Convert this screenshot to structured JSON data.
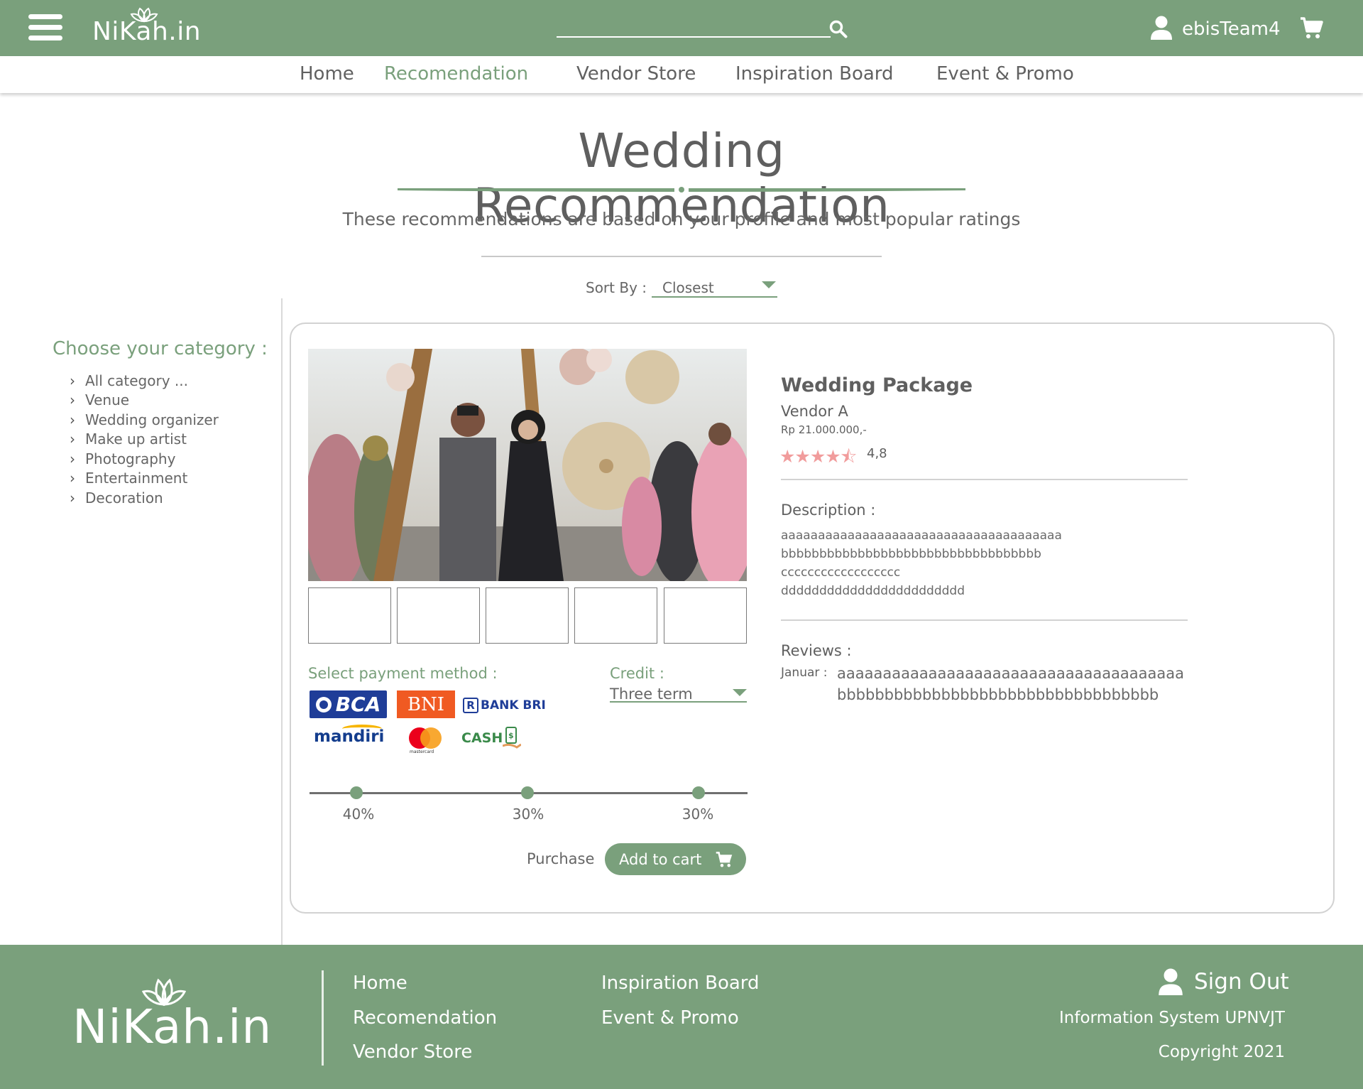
{
  "header": {
    "logo": "NiKah.in",
    "username": "ebisTeam4",
    "icons": [
      "hamburger-icon",
      "search-icon",
      "user-icon",
      "cart-icon"
    ]
  },
  "nav": {
    "items": [
      "Home",
      "Recomendation",
      "Vendor Store",
      "Inspiration Board",
      "Event & Promo"
    ],
    "active": "Recomendation"
  },
  "page": {
    "title": "Wedding Recommendation",
    "subtitle": "These recommendations are based on your profile and most popular ratings",
    "sort_label": "Sort By :",
    "sort_value": "Closest"
  },
  "sidebar": {
    "title": "Choose your category :",
    "items": [
      "All category ...",
      "Venue",
      "Wedding organizer",
      "Make up artist",
      "Photography",
      "Entertainment",
      "Decoration"
    ]
  },
  "product": {
    "title": "Wedding Package",
    "vendor": "Vendor  A",
    "price": "Rp 21.000.000,-",
    "stars": "★★★★⯪",
    "rating_value": 4.8,
    "rating": "4,8",
    "description_label": "Description :",
    "description_lines": [
      "aaaaaaaaaaaaaaaaaaaaaaaaaaaaaaaaaaaaaa",
      "bbbbbbbbbbbbbbbbbbbbbbbbbbbbbbbbbb",
      "cccccccccccccccccc",
      "dddddddddddddddddddddddd"
    ],
    "reviews_label": "Reviews :",
    "review_author": "Januar :",
    "review_lines": [
      "aaaaaaaaaaaaaaaaaaaaaaaaaaaaaaaaaaaaaa",
      "bbbbbbbbbbbbbbbbbbbbbbbbbbbbbbbbbb"
    ]
  },
  "payment": {
    "title": "Select payment method :",
    "methods": [
      "BCA",
      "BNI",
      "BANK BRI",
      "mandiri",
      "mastercard",
      "CASH"
    ],
    "credit_label": "Credit :",
    "credit_value": "Three term",
    "terms": [
      "40%",
      "30%",
      "30%"
    ],
    "term_values": [
      40,
      30,
      30
    ]
  },
  "actions": {
    "purchase": "Purchase",
    "add_to_cart": "Add to cart"
  },
  "footer": {
    "logo": "NiKah.in",
    "links_col1": [
      "Home",
      "Recomendation",
      "Vendor Store"
    ],
    "links_col2": [
      "Inspiration Board",
      "Event & Promo"
    ],
    "sign_out": "Sign Out",
    "org": "Information System UPNVJT",
    "copyright": "Copyright 2021"
  },
  "colors": {
    "brand_green": "#7aa07c",
    "star_pink": "#f19c9c",
    "text_gray": "#5f5f5f"
  }
}
